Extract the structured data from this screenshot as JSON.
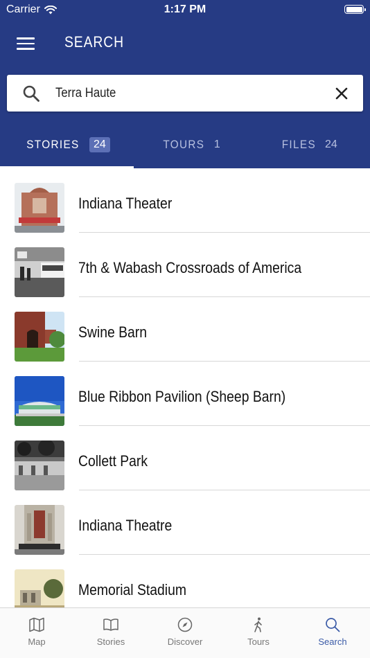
{
  "status_bar": {
    "carrier": "Carrier",
    "time": "1:17 PM"
  },
  "header": {
    "title": "SEARCH"
  },
  "search": {
    "query": "Terra Haute"
  },
  "tabs": [
    {
      "label": "STORIES",
      "count": "24",
      "active": true
    },
    {
      "label": "TOURS",
      "count": "1",
      "active": false
    },
    {
      "label": "FILES",
      "count": "24",
      "active": false
    }
  ],
  "results": [
    {
      "title": "Indiana Theater"
    },
    {
      "title": "7th & Wabash Crossroads of America"
    },
    {
      "title": "Swine Barn"
    },
    {
      "title": "Blue Ribbon Pavilion (Sheep Barn)"
    },
    {
      "title": "Collett Park"
    },
    {
      "title": "Indiana Theatre"
    },
    {
      "title": "Memorial Stadium"
    }
  ],
  "tab_bar": [
    {
      "label": "Map",
      "icon": "map-icon"
    },
    {
      "label": "Stories",
      "icon": "book-icon"
    },
    {
      "label": "Discover",
      "icon": "compass-icon"
    },
    {
      "label": "Tours",
      "icon": "walking-icon"
    },
    {
      "label": "Search",
      "icon": "search-icon",
      "active": true
    }
  ],
  "colors": {
    "header": "#263b84",
    "active_tab_bar": "#3b5ba7",
    "count_badge": "#5c70b6"
  }
}
